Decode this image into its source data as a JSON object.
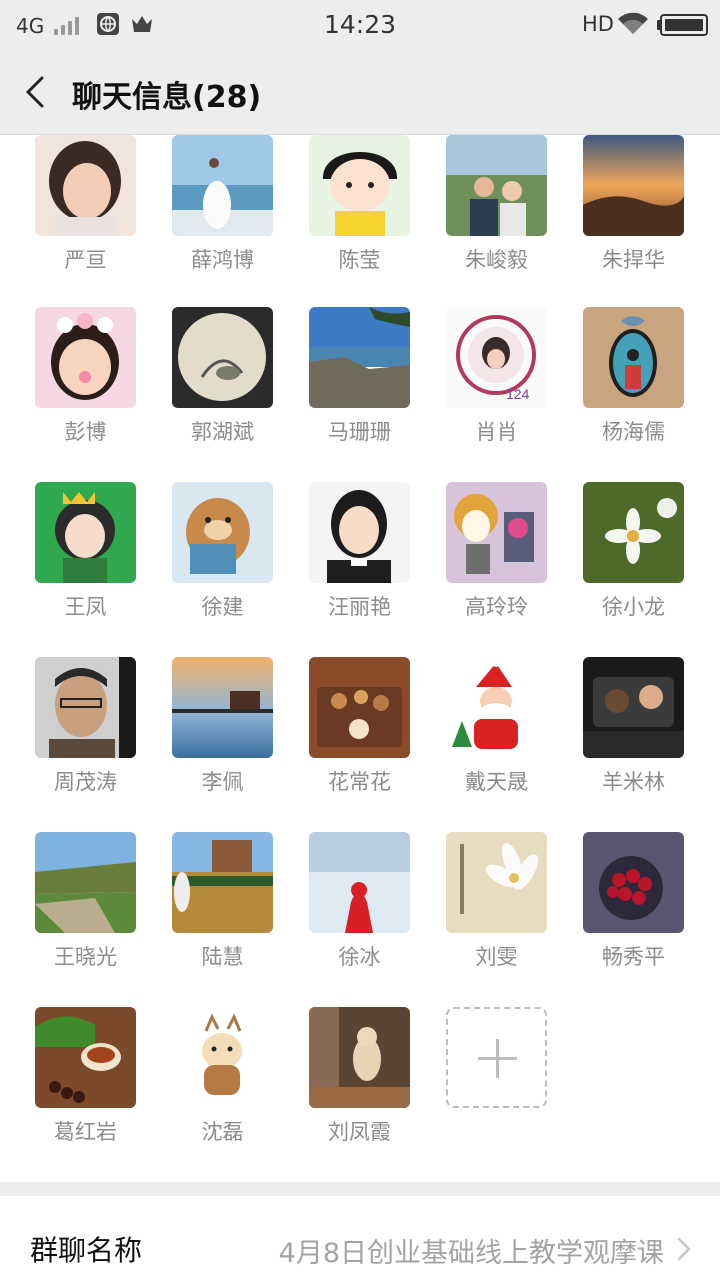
{
  "status_bar": {
    "network": "4G",
    "time": "14:23",
    "hd": "HD"
  },
  "header": {
    "title": "聊天信息(28)"
  },
  "members": [
    {
      "name": "严亘"
    },
    {
      "name": "薛鸿博"
    },
    {
      "name": "陈莹"
    },
    {
      "name": "朱峻毅"
    },
    {
      "name": "朱捍华"
    },
    {
      "name": "彭博"
    },
    {
      "name": "郭湖斌"
    },
    {
      "name": "马珊珊"
    },
    {
      "name": "肖肖"
    },
    {
      "name": "杨海儒"
    },
    {
      "name": "王凤"
    },
    {
      "name": "徐建"
    },
    {
      "name": "汪丽艳"
    },
    {
      "name": "高玲玲"
    },
    {
      "name": "徐小龙"
    },
    {
      "name": "周茂涛"
    },
    {
      "name": "李佩"
    },
    {
      "name": "花常花"
    },
    {
      "name": "戴天晟"
    },
    {
      "name": "羊米林"
    },
    {
      "name": "王晓光"
    },
    {
      "name": "陆慧"
    },
    {
      "name": "徐冰"
    },
    {
      "name": "刘雯"
    },
    {
      "name": "畅秀平"
    },
    {
      "name": "葛红岩"
    },
    {
      "name": "沈磊"
    },
    {
      "name": "刘凤霞"
    }
  ],
  "group_name": {
    "label": "群聊名称",
    "value": "4月8日创业基础线上教学观摩课"
  }
}
